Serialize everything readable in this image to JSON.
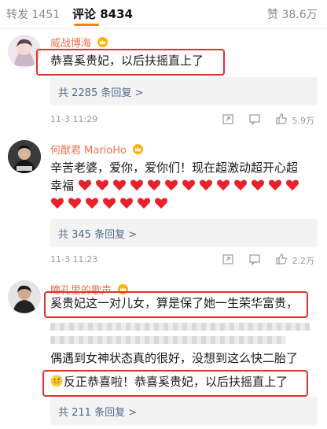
{
  "tabs": {
    "repost_label": "转发",
    "repost_count": "1451",
    "comment_label": "评论",
    "comment_count": "8434",
    "like_label": "赞",
    "like_count": "38.6万"
  },
  "comments": [
    {
      "author": "威战博海",
      "text": "恭喜奚贵妃，以后扶摇直上了",
      "replies": "共 2285 条回复 >",
      "time": "11-3 11:29",
      "likes": "5.9万"
    },
    {
      "author": "何猷君 MarioHo",
      "text_line1": "辛苦老婆，爱你，爱你们！现在超激动超开心超",
      "text_line2": "幸福",
      "heart_emoji": "heart-emoji",
      "replies": "共 345 条回复 >",
      "time": "11-3 11:23",
      "likes": "2.2万"
    },
    {
      "author": "瞳孔里的歌声",
      "text_line1": "奚贵妃这一对儿女，算是保了她一生荣华富贵，",
      "text_line3": "偶遇到女神状态真的很好，没想到这么快二胎了",
      "text_line4": "反正恭喜啦！恭喜奚贵妃，以后扶摇直上了",
      "emoji": "grin-sweat-emoji",
      "replies": "共 211 条回复 >"
    }
  ],
  "colors": {
    "accent": "#ff8200",
    "author": "#eb7350",
    "highlight_box": "#e4302b",
    "link": "#506b8d"
  },
  "icons": [
    "share-icon",
    "comment-icon",
    "like-icon",
    "crown-icon"
  ]
}
